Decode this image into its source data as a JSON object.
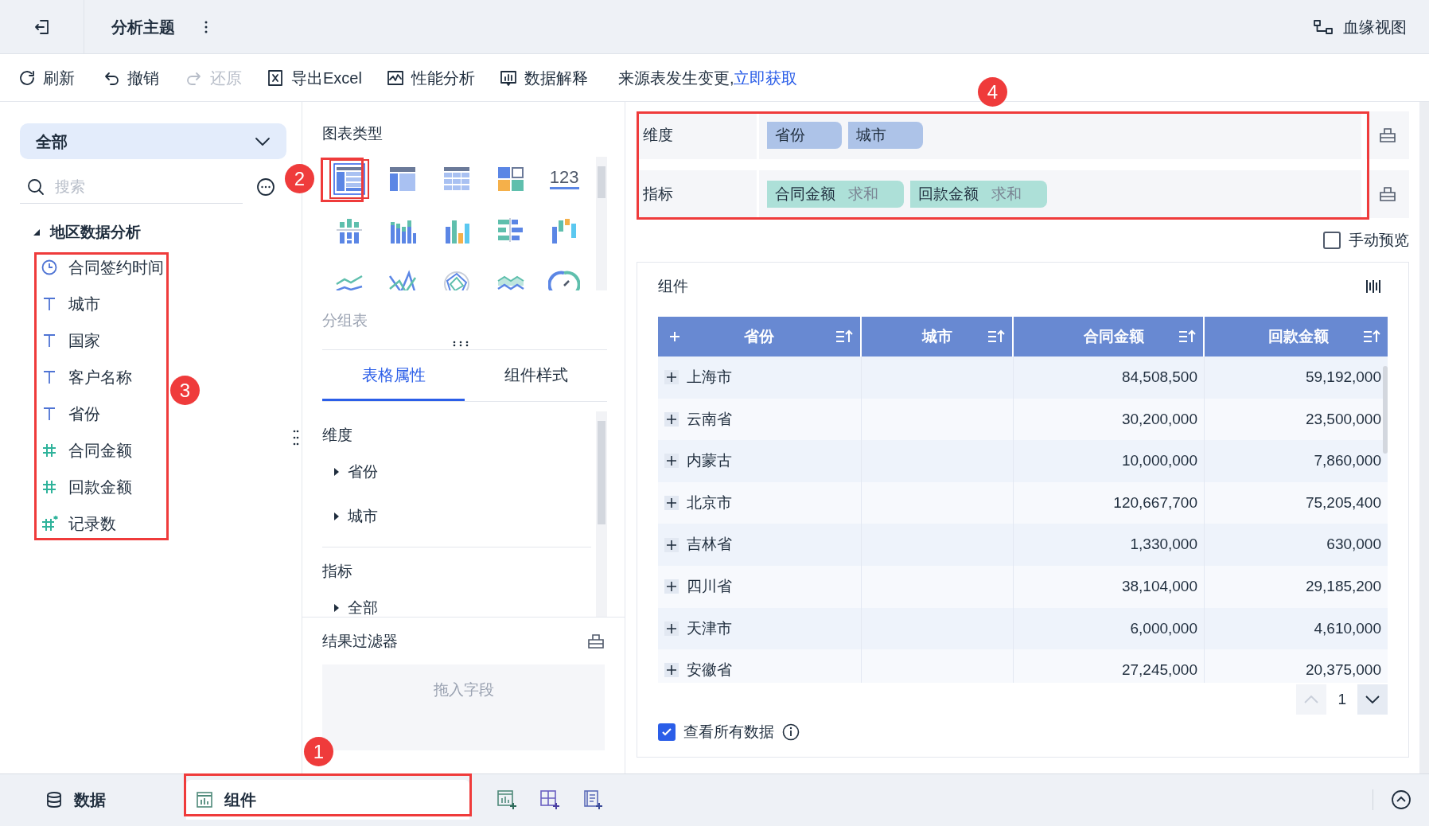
{
  "header": {
    "title": "分析主题",
    "lineage_button": "血缘视图"
  },
  "toolbar": [
    {
      "kind": "refresh",
      "label": "刷新",
      "disabled": false
    },
    {
      "kind": "undo",
      "label": "撤销",
      "disabled": false
    },
    {
      "kind": "redo",
      "label": "还原",
      "disabled": true
    },
    {
      "kind": "export",
      "label": "导出Excel",
      "disabled": false
    },
    {
      "kind": "performance",
      "label": "性能分析",
      "disabled": false
    },
    {
      "kind": "explain",
      "label": "数据解释",
      "disabled": false
    }
  ],
  "notice": {
    "text": "来源表发生变更,",
    "link": "立即获取"
  },
  "left_panel": {
    "dropdown": "全部",
    "search_placeholder": "搜索",
    "tree": {
      "label": "地区数据分析",
      "expanded": true,
      "children": [
        {
          "label": "合同签约时间",
          "kind": "date"
        },
        {
          "label": "城市",
          "kind": "text"
        },
        {
          "label": "国家",
          "kind": "text"
        },
        {
          "label": "客户名称",
          "kind": "text"
        },
        {
          "label": "省份",
          "kind": "text"
        },
        {
          "label": "合同金额",
          "kind": "number"
        },
        {
          "label": "回款金额",
          "kind": "number"
        },
        {
          "label": "记录数",
          "kind": "count"
        }
      ]
    }
  },
  "chart_types": {
    "title": "图表类型",
    "items": [
      {
        "kind": "group_table",
        "selected": true
      },
      {
        "kind": "cross_table",
        "selected": false
      },
      {
        "kind": "detail_table",
        "selected": false
      },
      {
        "kind": "tiles",
        "selected": false
      },
      {
        "kind": "kpi",
        "label": "123",
        "selected": false
      },
      {
        "kind": "stacked_bar",
        "selected": false
      },
      {
        "kind": "multi_bar",
        "selected": false
      },
      {
        "kind": "bar",
        "selected": false
      },
      {
        "kind": "bar_h",
        "selected": false
      },
      {
        "kind": "waterfall",
        "selected": false
      },
      {
        "kind": "line",
        "selected": false
      },
      {
        "kind": "line_cross",
        "selected": false
      },
      {
        "kind": "radar",
        "selected": false
      },
      {
        "kind": "area",
        "selected": false
      },
      {
        "kind": "gauge",
        "selected": false
      }
    ],
    "selected_name": "分组表"
  },
  "property_tabs": [
    {
      "label": "表格属性",
      "selected": true
    },
    {
      "label": "组件样式",
      "selected": false
    }
  ],
  "properties": [
    {
      "title": "维度",
      "items": [
        {
          "label": "省份"
        },
        {
          "label": "城市"
        }
      ]
    },
    {
      "title": "指标",
      "items": [
        {
          "label": "全部"
        }
      ]
    }
  ],
  "result_filter": {
    "title": "结果过滤器",
    "placeholder": "拖入字段"
  },
  "shelves": [
    {
      "label": "维度",
      "kind": "dimension",
      "fields": [
        {
          "name": "省份"
        },
        {
          "name": "城市"
        }
      ]
    },
    {
      "label": "指标",
      "kind": "metric",
      "fields": [
        {
          "name": "合同金额",
          "aggregation": "求和"
        },
        {
          "name": "回款金额",
          "aggregation": "求和"
        }
      ]
    }
  ],
  "manual_preview": {
    "label": "手动预览",
    "checked": false
  },
  "component": {
    "title": "组件",
    "table": {
      "columns": [
        {
          "label": "省份"
        },
        {
          "label": "城市"
        },
        {
          "label": "合同金额"
        },
        {
          "label": "回款金额"
        }
      ],
      "rows": [
        [
          "上海市",
          "",
          "84,508,500",
          "59,192,000"
        ],
        [
          "云南省",
          "",
          "30,200,000",
          "23,500,000"
        ],
        [
          "内蒙古",
          "",
          "10,000,000",
          "7,860,000"
        ],
        [
          "北京市",
          "",
          "120,667,700",
          "75,205,400"
        ],
        [
          "吉林省",
          "",
          "1,330,000",
          "630,000"
        ],
        [
          "四川省",
          "",
          "38,104,000",
          "29,185,200"
        ],
        [
          "天津市",
          "",
          "6,000,000",
          "4,610,000"
        ],
        [
          "安徽省",
          "",
          "27,245,000",
          "20,375,000"
        ]
      ]
    },
    "page": "1",
    "show_all": {
      "label": "查看所有数据",
      "checked": true
    }
  },
  "bottom_tabs": [
    {
      "kind": "data",
      "label": "数据",
      "selected": false
    },
    {
      "kind": "component",
      "label": "组件",
      "selected": true
    }
  ],
  "annotations": [
    {
      "label": "1"
    },
    {
      "label": "2"
    },
    {
      "label": "3"
    },
    {
      "label": "4"
    }
  ]
}
